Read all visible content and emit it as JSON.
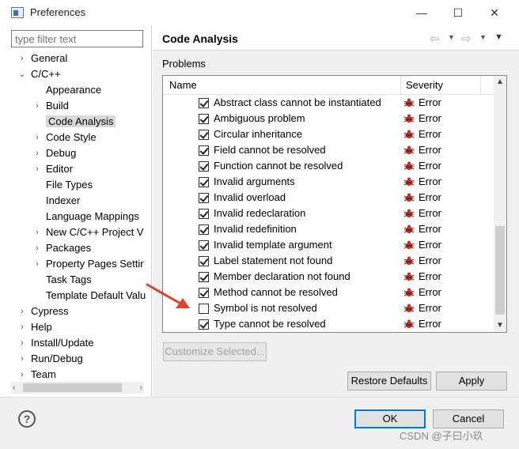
{
  "window": {
    "title": "Preferences",
    "minimize": "—",
    "maximize": "☐",
    "close": "✕"
  },
  "filter": {
    "placeholder": "type filter text"
  },
  "tree": [
    {
      "label": "General",
      "indent": 0,
      "twisty": "›"
    },
    {
      "label": "C/C++",
      "indent": 0,
      "twisty": "⌄"
    },
    {
      "label": "Appearance",
      "indent": 1,
      "twisty": ""
    },
    {
      "label": "Build",
      "indent": 1,
      "twisty": "›"
    },
    {
      "label": "Code Analysis",
      "indent": 1,
      "twisty": "",
      "selected": true
    },
    {
      "label": "Code Style",
      "indent": 1,
      "twisty": "›"
    },
    {
      "label": "Debug",
      "indent": 1,
      "twisty": "›"
    },
    {
      "label": "Editor",
      "indent": 1,
      "twisty": "›"
    },
    {
      "label": "File Types",
      "indent": 1,
      "twisty": ""
    },
    {
      "label": "Indexer",
      "indent": 1,
      "twisty": ""
    },
    {
      "label": "Language Mappings",
      "indent": 1,
      "twisty": ""
    },
    {
      "label": "New C/C++ Project V",
      "indent": 1,
      "twisty": "›"
    },
    {
      "label": "Packages",
      "indent": 1,
      "twisty": "›"
    },
    {
      "label": "Property Pages Settir",
      "indent": 1,
      "twisty": "›"
    },
    {
      "label": "Task Tags",
      "indent": 1,
      "twisty": ""
    },
    {
      "label": "Template Default Valu",
      "indent": 1,
      "twisty": ""
    },
    {
      "label": "Cypress",
      "indent": 0,
      "twisty": "›"
    },
    {
      "label": "Help",
      "indent": 0,
      "twisty": "›"
    },
    {
      "label": "Install/Update",
      "indent": 0,
      "twisty": "›"
    },
    {
      "label": "Run/Debug",
      "indent": 0,
      "twisty": "›"
    },
    {
      "label": "Team",
      "indent": 0,
      "twisty": "›"
    }
  ],
  "page": {
    "title": "Code Analysis",
    "section": "Problems"
  },
  "table": {
    "col_name": "Name",
    "col_severity": "Severity",
    "rows": [
      {
        "name": "Abstract class cannot be instantiated",
        "severity": "Error",
        "checked": true
      },
      {
        "name": "Ambiguous problem",
        "severity": "Error",
        "checked": true
      },
      {
        "name": "Circular inheritance",
        "severity": "Error",
        "checked": true
      },
      {
        "name": "Field cannot be resolved",
        "severity": "Error",
        "checked": true
      },
      {
        "name": "Function cannot be resolved",
        "severity": "Error",
        "checked": true
      },
      {
        "name": "Invalid arguments",
        "severity": "Error",
        "checked": true
      },
      {
        "name": "Invalid overload",
        "severity": "Error",
        "checked": true
      },
      {
        "name": "Invalid redeclaration",
        "severity": "Error",
        "checked": true
      },
      {
        "name": "Invalid redefinition",
        "severity": "Error",
        "checked": true
      },
      {
        "name": "Invalid template argument",
        "severity": "Error",
        "checked": true
      },
      {
        "name": "Label statement not found",
        "severity": "Error",
        "checked": true
      },
      {
        "name": "Member declaration not found",
        "severity": "Error",
        "checked": true
      },
      {
        "name": "Method cannot be resolved",
        "severity": "Error",
        "checked": true
      },
      {
        "name": "Symbol is not resolved",
        "severity": "Error",
        "checked": false
      },
      {
        "name": "Type cannot be resolved",
        "severity": "Error",
        "checked": true
      }
    ]
  },
  "buttons": {
    "customize": "Customize Selected...",
    "restore": "Restore Defaults",
    "apply": "Apply",
    "ok": "OK",
    "cancel": "Cancel",
    "help": "?"
  },
  "watermark": "CSDN @子曰小玖",
  "colors": {
    "accent": "#0078d7",
    "arrow": "#e8402f",
    "selection": "#d9d9d9"
  }
}
